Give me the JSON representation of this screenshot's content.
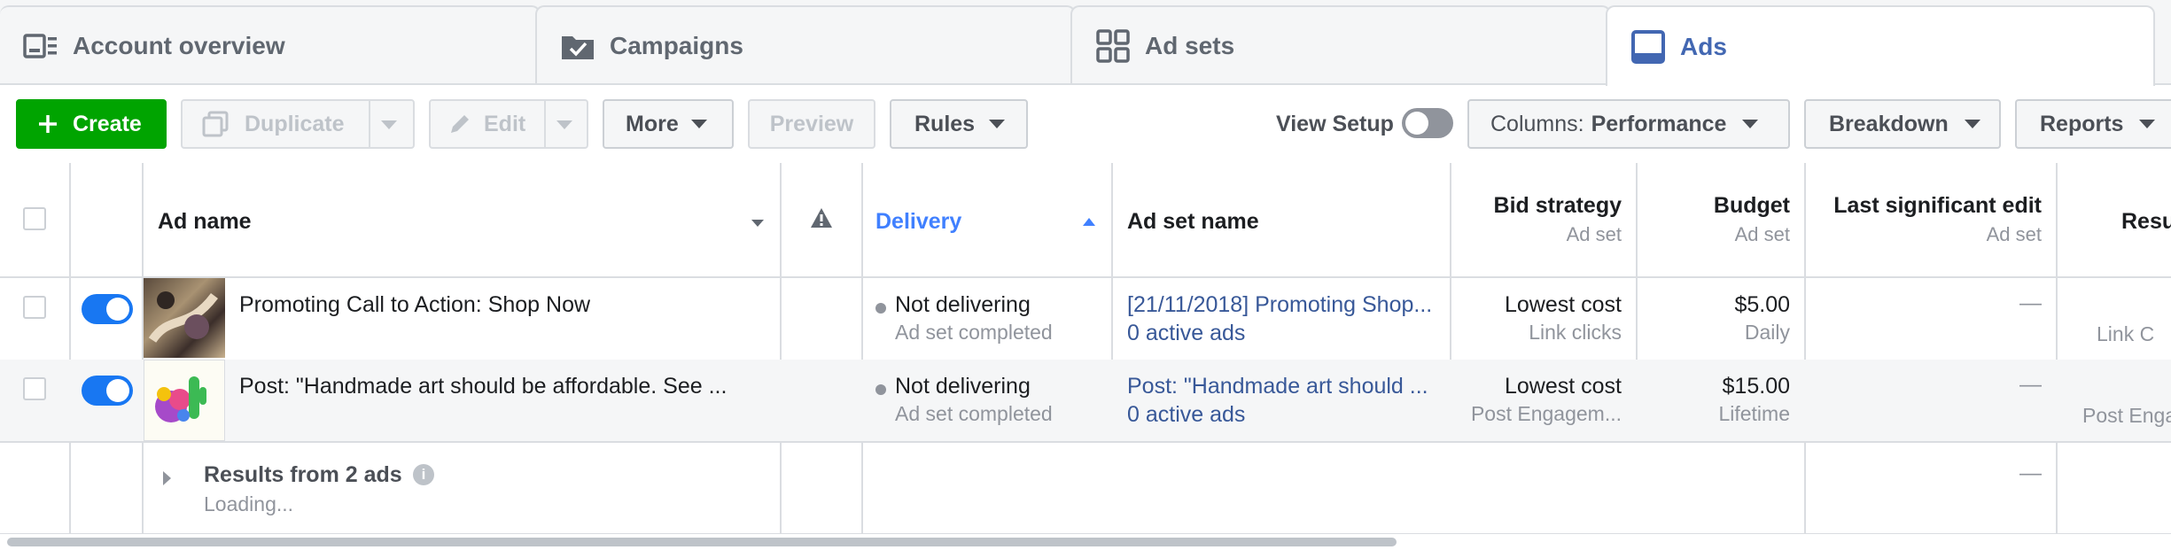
{
  "tabs": [
    {
      "label": "Account overview",
      "icon": "account-overview-icon"
    },
    {
      "label": "Campaigns",
      "icon": "campaigns-folder-icon"
    },
    {
      "label": "Ad sets",
      "icon": "ad-sets-grid-icon"
    },
    {
      "label": "Ads",
      "icon": "ads-monitor-icon",
      "active": true
    }
  ],
  "toolbar": {
    "create": "Create",
    "duplicate": "Duplicate",
    "edit": "Edit",
    "more": "More",
    "preview": "Preview",
    "rules": "Rules",
    "view_setup": "View Setup",
    "columns_prefix": "Columns:",
    "columns_value": "Performance",
    "breakdown": "Breakdown",
    "reports": "Reports"
  },
  "table": {
    "headers": {
      "ad_name": "Ad name",
      "delivery": "Delivery",
      "ad_set_name": "Ad set name",
      "bid_strategy": "Bid strategy",
      "bid_strategy_sub": "Ad set",
      "budget": "Budget",
      "budget_sub": "Ad set",
      "last_edit": "Last significant edit",
      "last_edit_sub": "Ad set",
      "results": "Resu"
    },
    "rows": [
      {
        "ad_name": "Promoting Call to Action: Shop Now",
        "delivery": "Not delivering",
        "delivery_sub": "Ad set completed",
        "ad_set_name": "[21/11/2018] Promoting Shop...",
        "ad_set_sub": "0 active ads",
        "bid": "Lowest cost",
        "bid_sub": "Link clicks",
        "budget": "$5.00",
        "budget_sub": "Daily",
        "last_edit": "—",
        "results_sub": "Link C"
      },
      {
        "ad_name": "Post: \"Handmade art should be affordable. See ...",
        "delivery": "Not delivering",
        "delivery_sub": "Ad set completed",
        "ad_set_name": "Post: \"Handmade art should ...",
        "ad_set_sub": "0 active ads",
        "bid": "Lowest cost",
        "bid_sub": "Post Engagem...",
        "budget": "$15.00",
        "budget_sub": "Lifetime",
        "last_edit": "—",
        "results_sub": "Post Enga"
      }
    ],
    "summary": {
      "label": "Results from 2 ads",
      "loading": "Loading...",
      "last_edit": "—"
    }
  },
  "colors": {
    "accent": "#4267b2",
    "create_green": "#00a400",
    "toggle_blue": "#1877f2",
    "delivery_blue": "#4080ff"
  }
}
